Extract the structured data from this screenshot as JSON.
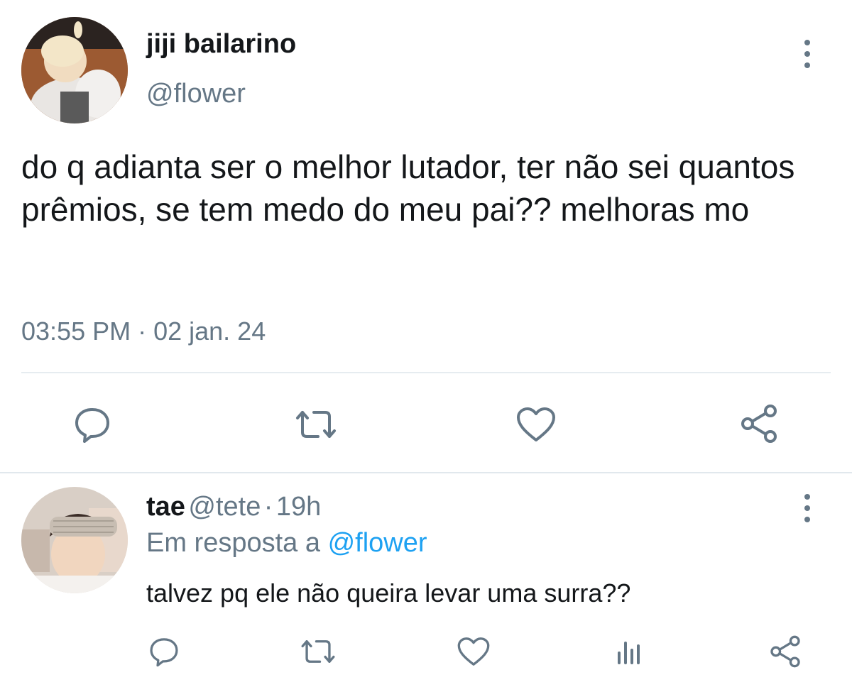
{
  "tweet": {
    "author_name": "jiji bailarino",
    "author_handle": "@flower",
    "text": "do q adianta ser o melhor lutador, ter não sei quantos prêmios, se tem medo do meu pai?? melhoras mo",
    "timestamp": "03:55 PM · 02 jan. 24",
    "actions": [
      "reply-icon",
      "retweet-icon",
      "like-icon",
      "share-icon"
    ]
  },
  "reply": {
    "author_name": "tae",
    "author_handle": "@tete",
    "separator": "·",
    "age": "19h",
    "in_reply_to_prefix": "Em resposta a",
    "in_reply_to_handle": "@flower",
    "text": "talvez pq ele não queira levar uma surra??",
    "actions": [
      "reply-icon",
      "retweet-icon",
      "like-icon",
      "analytics-icon",
      "share-icon"
    ]
  },
  "colors": {
    "text_primary": "#14171a",
    "text_secondary": "#657786",
    "link": "#1da1f2",
    "divider": "#e6ecf0"
  }
}
